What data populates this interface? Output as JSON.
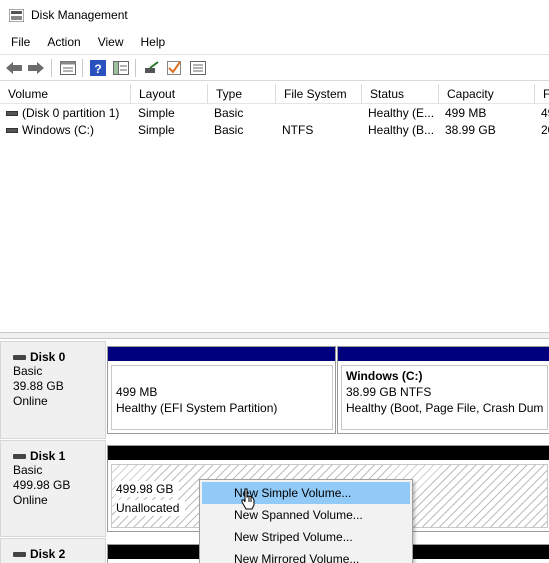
{
  "window": {
    "title": "Disk Management"
  },
  "menu": [
    "File",
    "Action",
    "View",
    "Help"
  ],
  "toolbar": {
    "icons": [
      "back-arrow-icon",
      "forward-arrow-icon",
      "properties-icon",
      "help-icon",
      "console-tree-icon",
      "connect-icon",
      "checkmark-icon",
      "list-icon"
    ]
  },
  "volume_list": {
    "columns": [
      "Volume",
      "Layout",
      "Type",
      "File System",
      "Status",
      "Capacity",
      "Fr"
    ],
    "rows": [
      {
        "volume": "(Disk 0 partition 1)",
        "layout": "Simple",
        "type": "Basic",
        "fs": "",
        "status": "Healthy (E...",
        "capacity": "499 MB",
        "free": "49"
      },
      {
        "volume": "Windows (C:)",
        "layout": "Simple",
        "type": "Basic",
        "fs": "NTFS",
        "status": "Healthy (B...",
        "capacity": "38.99 GB",
        "free": "20"
      }
    ]
  },
  "disks": [
    {
      "name": "Disk 0",
      "type": "Basic",
      "size": "39.88 GB",
      "state": "Online",
      "partitions": [
        {
          "title": "",
          "size": "499 MB",
          "status": "Healthy (EFI System Partition)"
        },
        {
          "title": "Windows  (C:)",
          "size": "38.99 GB NTFS",
          "status": "Healthy (Boot, Page File, Crash Dump, P"
        }
      ]
    },
    {
      "name": "Disk 1",
      "type": "Basic",
      "size": "499.98 GB",
      "state": "Online",
      "partitions": [
        {
          "title": "",
          "size": "499.98 GB",
          "status": "Unallocated"
        }
      ]
    },
    {
      "name": "Disk 2"
    }
  ],
  "context_menu": {
    "items": [
      "New Simple Volume...",
      "New Spanned Volume...",
      "New Striped Volume...",
      "New Mirrored Volume..."
    ],
    "highlighted": 0
  },
  "colors": {
    "primary_partition_bar": "#00007f",
    "unallocated_bar": "#000000",
    "menu_highlight": "#91c9f7"
  }
}
